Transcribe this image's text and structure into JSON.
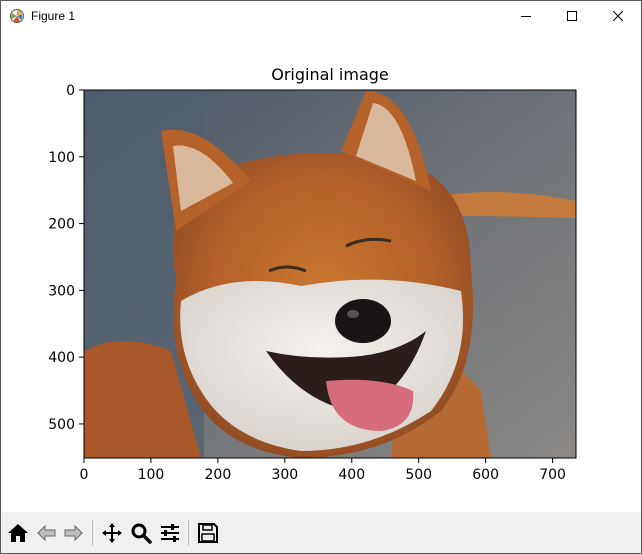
{
  "window": {
    "title": "Figure 1",
    "controls": [
      "minimize",
      "maximize",
      "close"
    ]
  },
  "figure": {
    "title": "Original image",
    "image_description": "photo of a smiling shiba inu dog"
  },
  "chart_data": {
    "type": "image",
    "title": "Original image",
    "xlabel": "",
    "ylabel": "",
    "xlim": [
      0,
      735
    ],
    "ylim": [
      551,
      0
    ],
    "xticks": [
      0,
      100,
      200,
      300,
      400,
      500,
      600,
      700
    ],
    "yticks": [
      0,
      100,
      200,
      300,
      400,
      500
    ]
  },
  "toolbar": {
    "buttons": [
      "home-icon",
      "back-icon",
      "forward-icon",
      "pan-icon",
      "zoom-icon",
      "configure-subplots-icon",
      "save-icon"
    ]
  }
}
